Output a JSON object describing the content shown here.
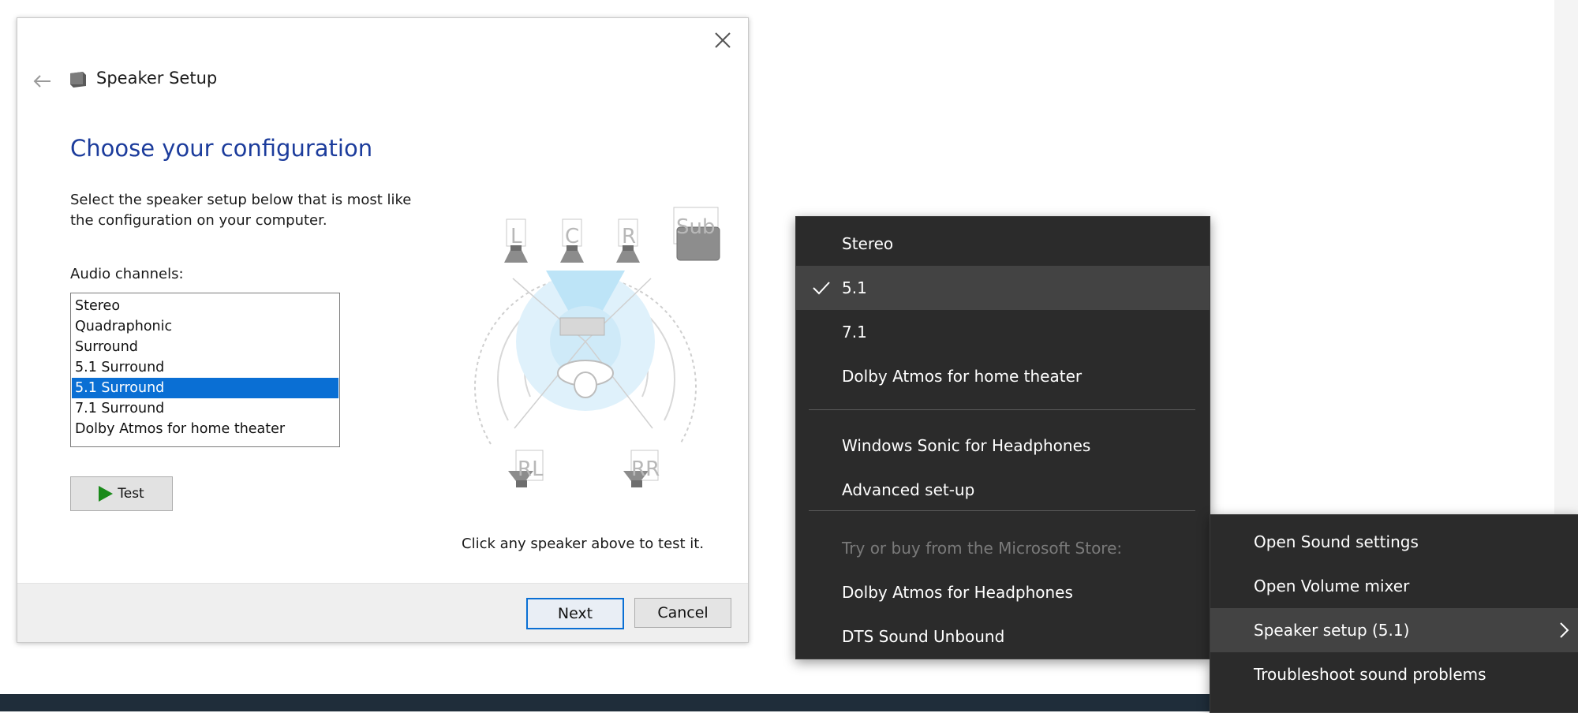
{
  "dialog": {
    "title": "Speaker Setup",
    "heading": "Choose your configuration",
    "instruction": "Select the speaker setup below that is most like the configuration on your computer.",
    "channels_label": "Audio channels:",
    "channels": [
      "Stereo",
      "Quadraphonic",
      "Surround",
      "5.1 Surround",
      "5.1 Surround",
      "7.1 Surround",
      "Dolby Atmos for home theater"
    ],
    "selected_channel_index": 4,
    "test_label": "Test",
    "hint": "Click any speaker above to test it.",
    "next_label": "Next",
    "cancel_label": "Cancel",
    "speaker_labels": {
      "left": "L",
      "center": "C",
      "right": "R",
      "sub": "Sub",
      "rear_left": "RL",
      "rear_right": "RR"
    }
  },
  "menu_left": {
    "items": [
      {
        "label": "Stereo"
      },
      {
        "label": "5.1",
        "checked": true
      },
      {
        "label": "7.1"
      },
      {
        "label": "Dolby Atmos for home theater"
      },
      {
        "label": "Windows Sonic for Headphones"
      },
      {
        "label": "Advanced set-up"
      },
      {
        "label": "Try or buy from the Microsoft Store:",
        "disabled": true
      },
      {
        "label": "Dolby Atmos for Headphones"
      },
      {
        "label": "DTS Sound Unbound"
      }
    ]
  },
  "menu_right": {
    "items": [
      {
        "label": "Open Sound settings"
      },
      {
        "label": "Open Volume mixer"
      },
      {
        "label": "Speaker setup (5.1)",
        "has_submenu": true
      },
      {
        "label": "Troubleshoot sound problems"
      }
    ]
  },
  "icons": {
    "close": "close-icon",
    "back": "back-arrow-icon",
    "title": "speaker-icon",
    "play": "play-icon",
    "check": "checkmark-icon",
    "chevron": "chevron-right-icon"
  },
  "colors": {
    "heading": "#1c3c9c",
    "selection": "#0a6fd4",
    "menu_bg": "#2b2b2b",
    "menu_active": "#434343",
    "test_play": "#1a8a1a"
  }
}
